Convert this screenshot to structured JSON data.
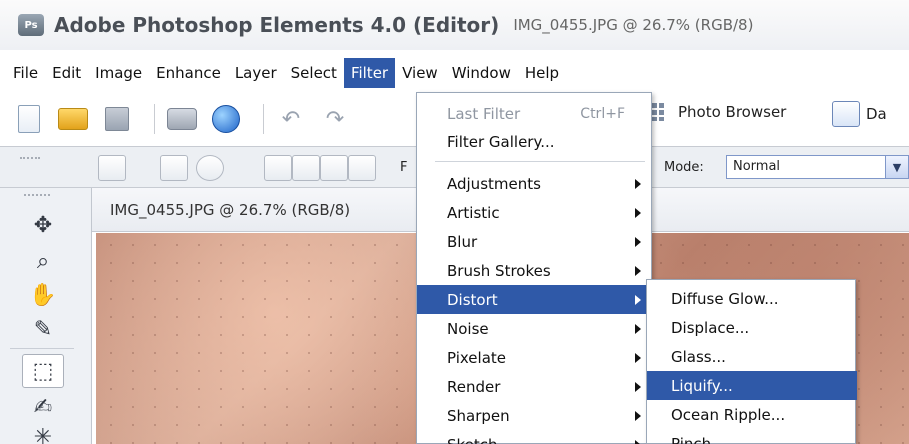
{
  "window": {
    "app_title": "Adobe Photoshop Elements 4.0 (Editor)",
    "doc_title": "IMG_0455.JPG @ 26.7% (RGB/8)"
  },
  "menubar": {
    "items": [
      "File",
      "Edit",
      "Image",
      "Enhance",
      "Layer",
      "Select",
      "Filter",
      "View",
      "Window",
      "Help"
    ],
    "active": "Filter"
  },
  "toolbar": {
    "photo_browser_label": "Photo Browser",
    "date_view_label": "Da"
  },
  "optionsbar": {
    "feather_label": "F",
    "mode_label": "Mode:",
    "mode_value": "Normal"
  },
  "document": {
    "tab_title": "IMG_0455.JPG @ 26.7% (RGB/8)"
  },
  "filter_menu": {
    "last_filter": "Last Filter",
    "last_filter_shortcut": "Ctrl+F",
    "filter_gallery": "Filter Gallery...",
    "items": [
      "Adjustments",
      "Artistic",
      "Blur",
      "Brush Strokes",
      "Distort",
      "Noise",
      "Pixelate",
      "Render",
      "Sharpen",
      "Sketch"
    ],
    "highlighted": "Distort"
  },
  "distort_submenu": {
    "items": [
      "Diffuse Glow...",
      "Displace...",
      "Glass...",
      "Liquify...",
      "Ocean Ripple...",
      "Pinch..."
    ],
    "highlighted": "Liquify..."
  },
  "colors": {
    "menu_highlight": "#2f59a8",
    "title_text": "#4a4f57"
  }
}
